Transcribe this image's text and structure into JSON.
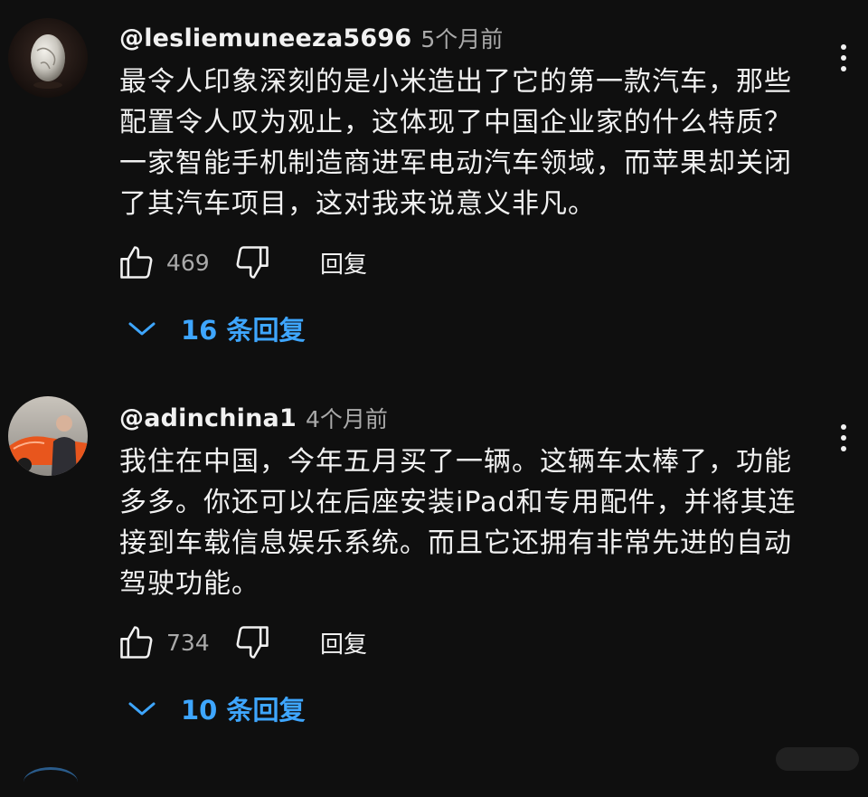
{
  "comments": [
    {
      "username": "@lesliemuneeza5696",
      "timestamp": "5个月前",
      "avatar_icon": "egg-sculpture-avatar",
      "text": "最令人印象深刻的是小米造出了它的第一款汽车，那些\n配置令人叹为观止，这体现了中国企业家的什么特质？\n一家智能手机制造商进军电动汽车领域，而苹果却关闭\n了其汽车项目，这对我来说意义非凡。",
      "likes": "469",
      "reply_label": "回复",
      "replies_label": "16 条回复"
    },
    {
      "username": "@adinchina1",
      "timestamp": "4个月前",
      "avatar_icon": "man-with-orange-car-avatar",
      "text": "我住在中国，今年五月买了一辆。这辆车太棒了，功能\n多多。你还可以在后座安装iPad和专用配件，并将其连\n接到车载信息娱乐系统。而且它还拥有非常先进的自动\n驾驶功能。",
      "likes": "734",
      "reply_label": "回复",
      "replies_label": "10 条回复"
    }
  ],
  "colors": {
    "background": "#0f0f0f",
    "text_primary": "#f1f1f1",
    "text_secondary": "#aaaaaa",
    "link_blue": "#3ea6ff"
  }
}
